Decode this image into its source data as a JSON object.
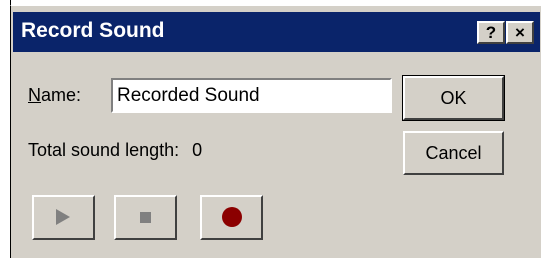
{
  "window": {
    "title": "Record Sound",
    "help_button": "?",
    "close_button": "×"
  },
  "form": {
    "name_label_prefix": "N",
    "name_label_rest": "ame:",
    "name_value": "Recorded Sound",
    "length_label": "Total sound length:",
    "length_value": "0"
  },
  "buttons": {
    "ok": "OK",
    "cancel": "Cancel"
  },
  "controls": {
    "play": "play-icon",
    "stop": "stop-icon",
    "record": "record-icon"
  },
  "colors": {
    "titlebar": "#0a246a",
    "dialog_face": "#d4d0c8",
    "record_dot": "#8b0000",
    "disabled_icon": "#808080"
  }
}
